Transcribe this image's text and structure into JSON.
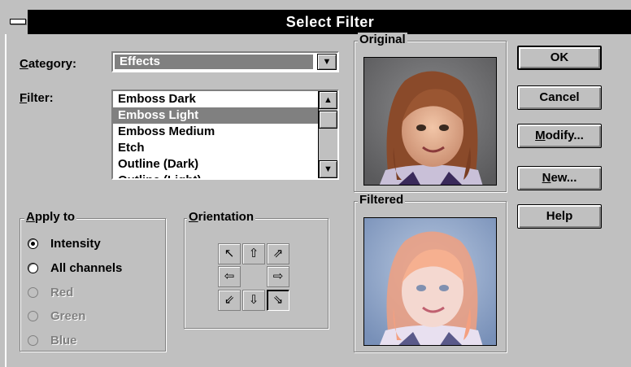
{
  "window": {
    "title": "Select Filter"
  },
  "category": {
    "label": "Category:",
    "value": "Effects"
  },
  "filter": {
    "label": "Filter:",
    "items": [
      "Emboss Dark",
      "Emboss Light",
      "Emboss Medium",
      "Etch",
      "Outline (Dark)",
      "Outline (Light)"
    ],
    "selected_index": 1
  },
  "apply_to": {
    "title": "Apply to",
    "options": [
      {
        "label": "Intensity",
        "checked": true,
        "enabled": true
      },
      {
        "label": "All channels",
        "checked": false,
        "enabled": true
      },
      {
        "label": "Red",
        "checked": false,
        "enabled": false
      },
      {
        "label": "Green",
        "checked": false,
        "enabled": false
      },
      {
        "label": "Blue",
        "checked": false,
        "enabled": false
      }
    ]
  },
  "orientation": {
    "title": "Orientation",
    "selected": "bottom-right",
    "arrows": {
      "top-left": "↖",
      "top": "⇧",
      "top-right": "⇗",
      "left": "⇦",
      "right": "⇨",
      "bottom-left": "⇙",
      "bottom": "⇩",
      "bottom-right": "⇘"
    }
  },
  "preview": {
    "original_label": "Original",
    "filtered_label": "Filtered"
  },
  "buttons": {
    "ok": "OK",
    "cancel": "Cancel",
    "modify": "Modify...",
    "new": "New...",
    "help": "Help"
  },
  "icons": {
    "dropdown": "▼",
    "scroll_up": "▲",
    "scroll_down": "▼",
    "system_menu": "system-menu-icon"
  }
}
